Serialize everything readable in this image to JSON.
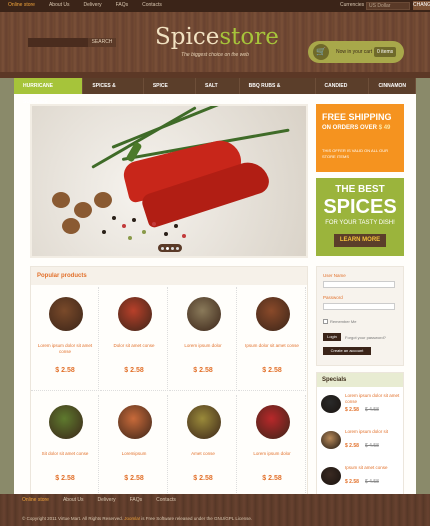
{
  "top_nav": {
    "items": [
      {
        "label": "Online store",
        "active": true
      },
      {
        "label": "About Us",
        "active": false
      },
      {
        "label": "Delivery",
        "active": false
      },
      {
        "label": "FAQs",
        "active": false
      },
      {
        "label": "Contacts",
        "active": false
      }
    ],
    "currencies_label": "Currencies",
    "currency_value": "US Dollar",
    "change_label": "CHANGE"
  },
  "header": {
    "search_button": "SEARCH",
    "logo_part1": "Spice",
    "logo_part2": "store",
    "tagline": "The biggest choice on the web",
    "cart_text": "Now in your cart",
    "cart_items": "0 items"
  },
  "main_nav": {
    "items": [
      {
        "label": "HURRICANE SUPPLIES",
        "active": true
      },
      {
        "label": "SPICES & HERBS ▾",
        "active": false
      },
      {
        "label": "SPICE BLENDS",
        "active": false
      },
      {
        "label": "SALT FREE",
        "active": false
      },
      {
        "label": "BBQ RUBS & MARINADES",
        "active": false
      },
      {
        "label": "CANDIED FRUIT",
        "active": false
      },
      {
        "label": "CINNAMON",
        "active": false
      }
    ]
  },
  "slider": {
    "current_page": 2,
    "page_count": 4
  },
  "promo_shipping": {
    "title": "FREE SHIPPING",
    "subtitle": "ON ORDERS OVER",
    "amount": "$ 49",
    "note": "THIS OFFER IS VALID ON ALL OUR STORE ITEMS"
  },
  "promo_spices": {
    "line1": "THE BEST",
    "line2": "SPICES",
    "line3": "FOR YOUR TASTY DISH!",
    "button": "LEARN MORE"
  },
  "popular": {
    "title": "Popular products",
    "products": [
      {
        "name": "Lorem ipsum dolor sit amet conse",
        "price": "$ 2.58",
        "color": "#7a4a2a"
      },
      {
        "name": "Dolor sit amet conse",
        "price": "$ 2.58",
        "color": "#b8402a"
      },
      {
        "name": "Lorem ipsum dolor",
        "price": "$ 2.58",
        "color": "#8a7a5a"
      },
      {
        "name": "Ipsum dolor sit amet conse",
        "price": "$ 2.58",
        "color": "#8a4a2a"
      },
      {
        "name": "Sit dolor sit amet conse",
        "price": "$ 2.58",
        "color": "#5e7a2e"
      },
      {
        "name": "Loremipsum",
        "price": "$ 2.58",
        "color": "#c86a3a"
      },
      {
        "name": "Amet conse",
        "price": "$ 2.58",
        "color": "#9a8a3a"
      },
      {
        "name": "Lorem ipsum dolor",
        "price": "$ 2.58",
        "color": "#b8282a"
      }
    ]
  },
  "login": {
    "user_label": "User Name",
    "password_label": "Password",
    "remember": "Remember Me",
    "login_button": "Login",
    "forgot": "Forgot your password?",
    "create_button": "Create an account"
  },
  "specials": {
    "title": "Specials",
    "items": [
      {
        "name": "Lorem ipsum dolor sit amet conse",
        "new_price": "$ 2.58",
        "old_price": "$ 4.58",
        "color": "#2a2a2a"
      },
      {
        "name": "Lorem ipsum dolor sit",
        "new_price": "$ 2.58",
        "old_price": "$ 4.58",
        "color": "#b88a5a"
      },
      {
        "name": "Ipsum sit amet conse",
        "new_price": "$ 2.58",
        "old_price": "$ 4.58",
        "color": "#3a2a22"
      }
    ]
  },
  "footer": {
    "items": [
      {
        "label": "Online store",
        "active": true
      },
      {
        "label": "About Us",
        "active": false
      },
      {
        "label": "Delivery",
        "active": false
      },
      {
        "label": "FAQs",
        "active": false
      },
      {
        "label": "Contacts",
        "active": false
      }
    ],
    "copyright": "© Copyright 2011 Virtue Mart. All Rights Reserved.",
    "joomla": "Joomla!",
    "license": "is Free Software released under the GNU/GPL License."
  },
  "colors": {
    "accent_orange": "#e2702a",
    "accent_green": "#a6c43a",
    "brown": "#5b3e2a"
  }
}
